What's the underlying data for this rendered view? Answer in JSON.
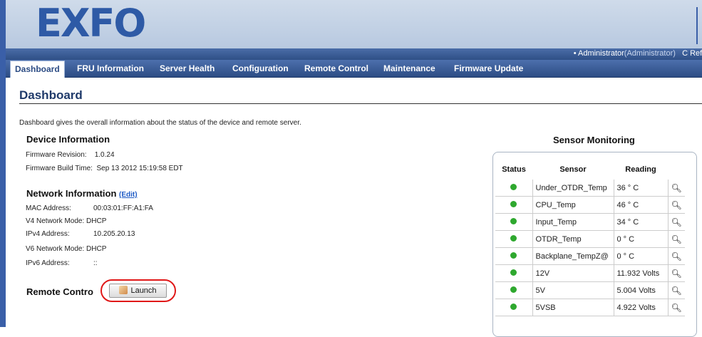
{
  "brand": {
    "logo": "EXFO"
  },
  "user": {
    "name": "Administrator",
    "role": "(Administrator)",
    "refresh": "C Refre"
  },
  "nav": [
    "Dashboard",
    "FRU Information",
    "Server Health",
    "Configuration",
    "Remote Control",
    "Maintenance",
    "Firmware Update"
  ],
  "page": {
    "title": "Dashboard",
    "description": "Dashboard gives the overall information about the status of the device and remote server."
  },
  "device": {
    "heading": "Device Information",
    "fw_rev_label": "Firmware Revision:",
    "fw_rev": "1.0.24",
    "fw_build_label": "Firmware Build Time:",
    "fw_build": "Sep 13 2012 15:19:58 EDT"
  },
  "network": {
    "heading": "Network Information",
    "edit": "(Edit)",
    "mac_label": "MAC Address:",
    "mac": "00:03:01:FF:A1:FA",
    "v4mode_label": "V4 Network Mode:",
    "v4mode": "DHCP",
    "ipv4_label": "IPv4 Address:",
    "ipv4": "10.205.20.13",
    "v6mode_label": "V6 Network Mode:",
    "v6mode": "DHCP",
    "ipv6_label": "IPv6 Address:",
    "ipv6": "::"
  },
  "remote": {
    "label": "Remote Contro",
    "launch": "Launch"
  },
  "sensors": {
    "title": "Sensor Monitoring",
    "headers": [
      "Status",
      "Sensor",
      "Reading"
    ],
    "rows": [
      {
        "sensor": "Under_OTDR_Temp",
        "reading": "36 ° C"
      },
      {
        "sensor": "CPU_Temp",
        "reading": "46 ° C"
      },
      {
        "sensor": "Input_Temp",
        "reading": "34 ° C"
      },
      {
        "sensor": "OTDR_Temp",
        "reading": "0 ° C"
      },
      {
        "sensor": "Backplane_TempZ@",
        "reading": "0 ° C"
      },
      {
        "sensor": "12V",
        "reading": "11.932 Volts"
      },
      {
        "sensor": "5V",
        "reading": "5.004 Volts"
      },
      {
        "sensor": "5VSB",
        "reading": "4.922 Volts"
      }
    ],
    "status_color": "#2ea82e"
  }
}
